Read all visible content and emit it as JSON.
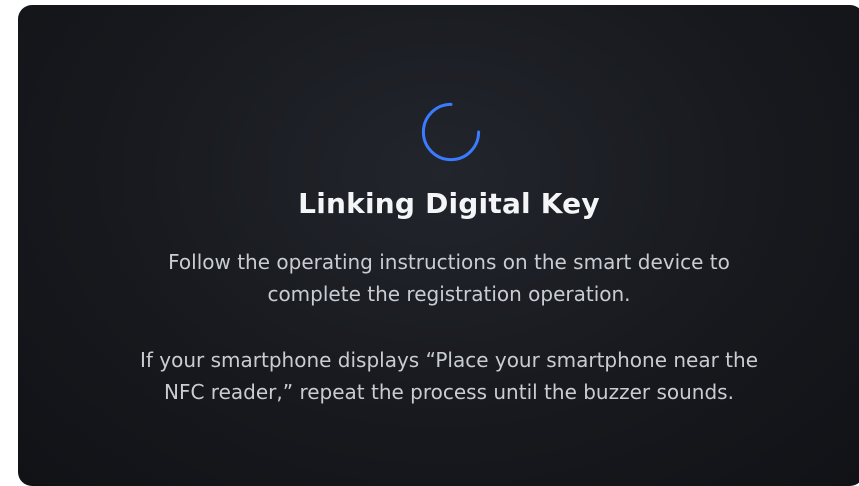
{
  "dialog": {
    "title": "Linking Digital Key",
    "instruction_lines": [
      "Follow the operating instructions on the smart device to",
      "complete the registration operation."
    ],
    "nfc_note_lines": [
      "If your smartphone displays “Place your smartphone near the",
      "NFC reader,” repeat the process until the buzzer sounds."
    ],
    "spinner_icon": "loading-spinner-icon"
  },
  "colors": {
    "background": "#17191e",
    "spinner": "#3b7bff",
    "title": "#f4f5f7",
    "body_text": "#c9ccd2"
  }
}
